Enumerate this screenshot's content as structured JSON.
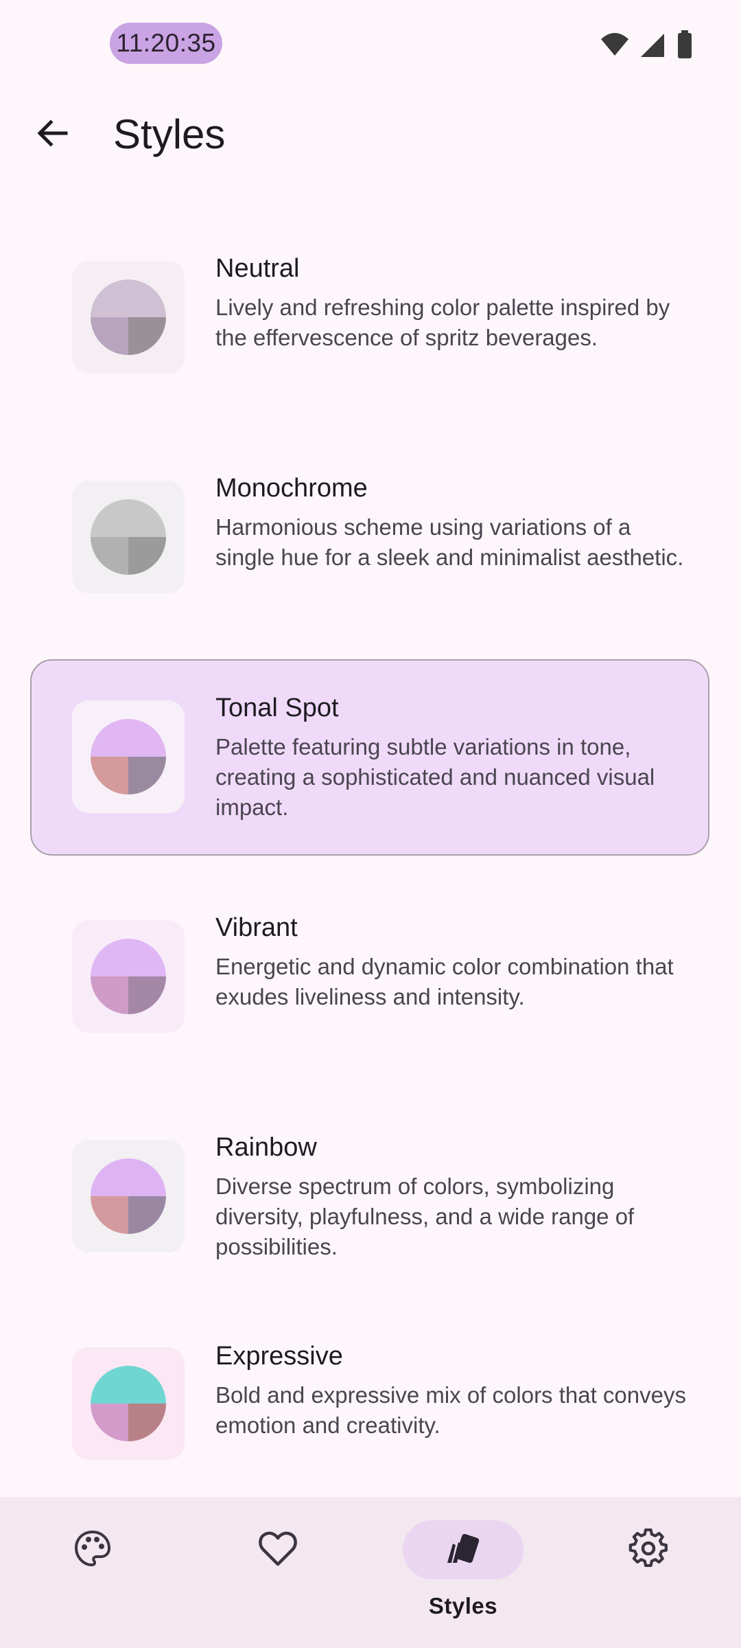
{
  "status_bar": {
    "time": "11:20:35",
    "wifi_badge": "4"
  },
  "header": {
    "title": "Styles",
    "back_icon": "arrow-back-icon"
  },
  "styles": [
    {
      "id": "neutral",
      "title": "Neutral",
      "description": "Lively and refreshing color palette inspired by the effervescence of spritz beverages.",
      "selected": false,
      "tile_bg": "#f5eff3",
      "colors": {
        "top": "#d0c0d3",
        "bottom_left": "#b8a4bf",
        "bottom_right": "#9a9097"
      }
    },
    {
      "id": "monochrome",
      "title": "Monochrome",
      "description": "Harmonious scheme using variations of a single hue for a sleek and minimalist aesthetic.",
      "selected": false,
      "tile_bg": "#f2f0f2",
      "colors": {
        "top": "#c8c8c8",
        "bottom_left": "#b1b1b1",
        "bottom_right": "#9b9b9b"
      }
    },
    {
      "id": "tonal-spot",
      "title": "Tonal Spot",
      "description": "Palette featuring subtle variations in tone, creating a sophisticated and nuanced visual impact.",
      "selected": true,
      "tile_bg": "#f8f0f9",
      "colors": {
        "top": "#e0b7f2",
        "bottom_left": "#d49a9c",
        "bottom_right": "#9a8aa0"
      }
    },
    {
      "id": "vibrant",
      "title": "Vibrant",
      "description": "Energetic and dynamic color combination that exudes liveliness and intensity.",
      "selected": false,
      "tile_bg": "#f8ecf9",
      "colors": {
        "top": "#e0b7f5",
        "bottom_left": "#cf9bc7",
        "bottom_right": "#a587a8"
      }
    },
    {
      "id": "rainbow",
      "title": "Rainbow",
      "description": "Diverse spectrum of colors, symbolizing diversity, playfulness, and a wide range of possibilities.",
      "selected": false,
      "tile_bg": "#f2f0f2",
      "colors": {
        "top": "#deb3f3",
        "bottom_left": "#d49b9e",
        "bottom_right": "#9a88a3"
      }
    },
    {
      "id": "expressive",
      "title": "Expressive",
      "description": "Bold and expressive mix of colors that conveys emotion and creativity.",
      "selected": false,
      "tile_bg": "#fbe8f4",
      "colors": {
        "top": "#6fd6d2",
        "bottom_left": "#d39bc9",
        "bottom_right": "#b88188"
      }
    }
  ],
  "bottom_nav": {
    "items": [
      {
        "id": "colors",
        "icon": "palette-icon",
        "label": "",
        "active": false
      },
      {
        "id": "favorites",
        "icon": "heart-icon",
        "label": "",
        "active": false
      },
      {
        "id": "styles",
        "icon": "styles-icon",
        "label": "Styles",
        "active": true
      },
      {
        "id": "settings",
        "icon": "gear-icon",
        "label": "",
        "active": false
      }
    ]
  }
}
